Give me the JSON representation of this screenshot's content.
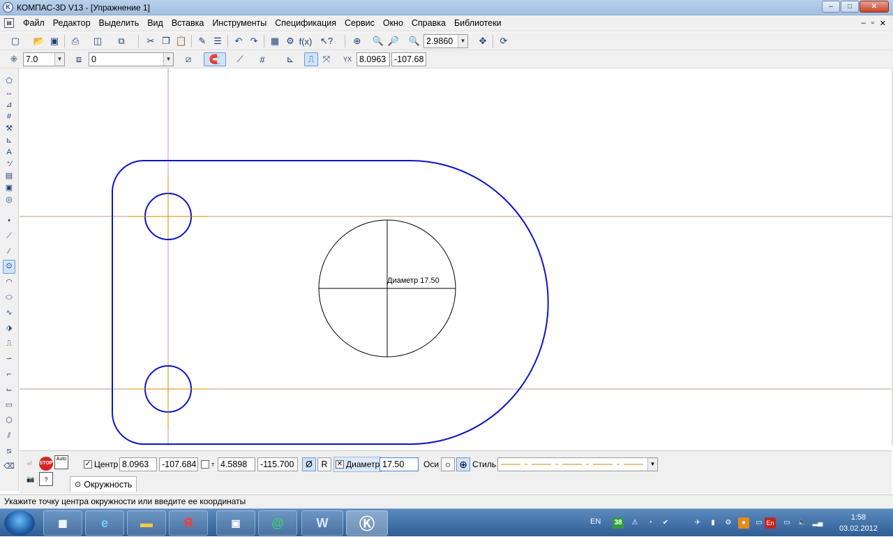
{
  "window": {
    "title": "КОМПАС-3D V13 - [Упражнение 1]",
    "minimize": "–",
    "maximize": "□",
    "close": "✕"
  },
  "menu": [
    "Файл",
    "Редактор",
    "Выделить",
    "Вид",
    "Вставка",
    "Инструменты",
    "Спецификация",
    "Сервис",
    "Окно",
    "Справка",
    "Библиотеки"
  ],
  "toolbar1": {
    "zoom_value": "2.9860",
    "icons": [
      "new-document-icon",
      "open-icon",
      "save-icon",
      "print-icon",
      "preview-icon",
      "manager-icon",
      "cut-icon",
      "copy-icon",
      "paste-icon",
      "properties-icon",
      "spec-icon",
      "undo-icon",
      "redo-icon",
      "library-icon",
      "variables-icon",
      "fx-icon",
      "help-pointer-icon",
      "zoom-all-icon",
      "zoom-in-icon",
      "zoom-window-icon",
      "zoom-scale-icon",
      "pan-icon",
      "refresh-icon"
    ]
  },
  "toolbar2": {
    "step_value": "7.0",
    "layer_value": "0",
    "cursor_x": "8.0963",
    "cursor_y": "-107.68",
    "y_axis_label": "Y",
    "x_axis_label": "X"
  },
  "canvas": {
    "dimension_label": "Диаметр 17.50"
  },
  "property_panel": {
    "center_label": "Центр",
    "center_x": "8.0963",
    "center_y": "-107.684",
    "point_label": "т",
    "point_x": "4.5898",
    "point_y": "-115.700",
    "diameter_symbol": "Ø",
    "radius_symbol": "R",
    "diameter_label": "Диаметр",
    "diameter_value": "17.50",
    "axes_label": "Оси",
    "style_label": "Стиль",
    "tab_label": "Окружность",
    "stop_label": "STOP",
    "auto_label": "Auto"
  },
  "status": {
    "message": "Укажите точку центра окружности или введите ее координаты"
  },
  "taskbar": {
    "apps": [
      "calculator-icon",
      "internet-explorer-icon",
      "explorer-folder-icon",
      "yandex-icon",
      "video-icon",
      "mail-agent-icon",
      "word-icon",
      "kompas-icon"
    ],
    "word_letter": "W",
    "yandex_letter": "Я",
    "mail_symbol": "@",
    "language": "EN",
    "badge_number": "38",
    "tray_lang": "En",
    "time": "1:58",
    "date": "03.02.2012"
  },
  "colors": {
    "contour": "#0a14c8",
    "axis": "#d28a00",
    "guide_h": "#b89a84",
    "guide_v": "#c39ac8",
    "circle": "#000000"
  }
}
